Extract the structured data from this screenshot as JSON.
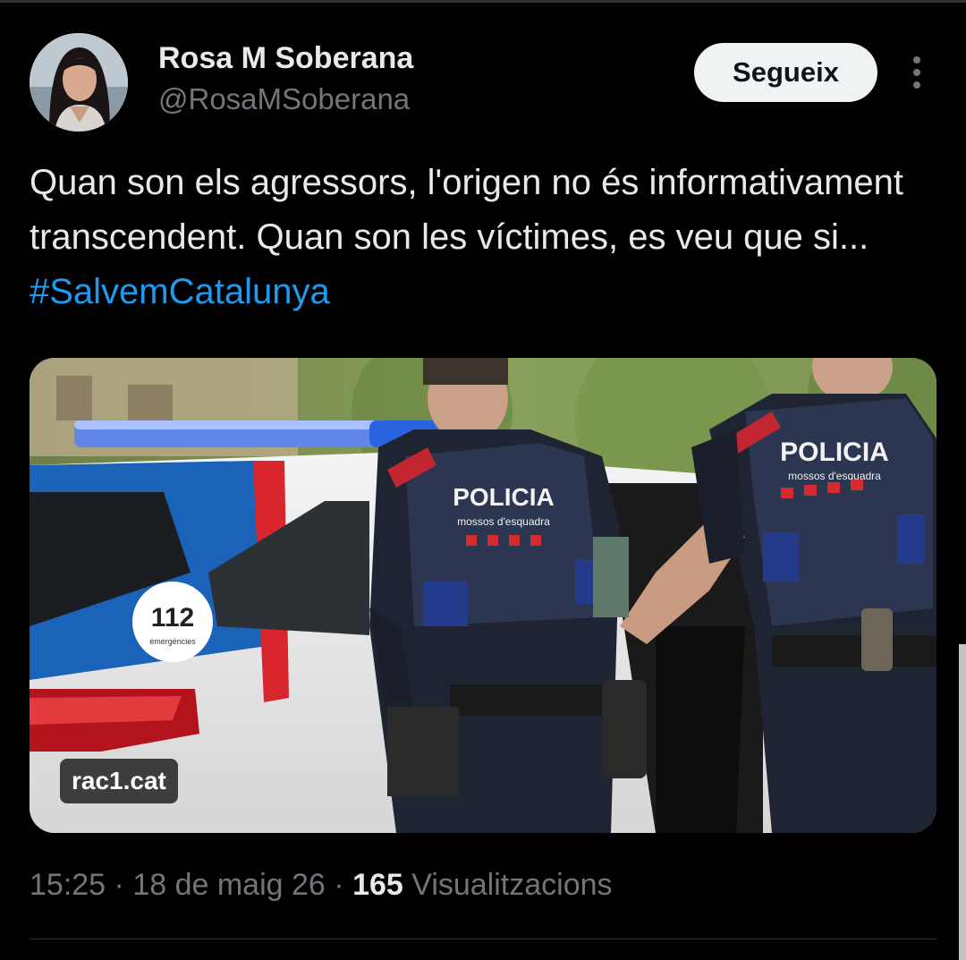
{
  "author": {
    "name": "Rosa M Soberana",
    "handle": "@RosaMSoberana",
    "avatar_icon": "profile-photo"
  },
  "follow_button": {
    "label": "Segueix"
  },
  "more_menu": {
    "icon": "more-vertical-icon"
  },
  "tweet": {
    "text": "Quan son els agressors, l'origen no és informativament transcendent. Quan son les víctimes, es veu que si...",
    "hashtag": "#SalvemCatalunya"
  },
  "media": {
    "source_label": "rac1.cat",
    "photo_texts": {
      "vest_left_title": "POLICIA",
      "vest_left_sub": "mossos d'esquadra",
      "vest_right_title": "POLICIA",
      "vest_right_sub": "mossos d'esquadra",
      "car_number": "112",
      "car_sub": "emergències"
    }
  },
  "meta": {
    "time": "15:25",
    "separator": "·",
    "date": "18 de maig 26",
    "views_count": "165",
    "views_label": "Visualitzacions"
  },
  "colors": {
    "background": "#000000",
    "text_primary": "#e7e9ea",
    "text_secondary": "#71767b",
    "link": "#1d9bf0",
    "button_bg": "#eff3f4"
  }
}
